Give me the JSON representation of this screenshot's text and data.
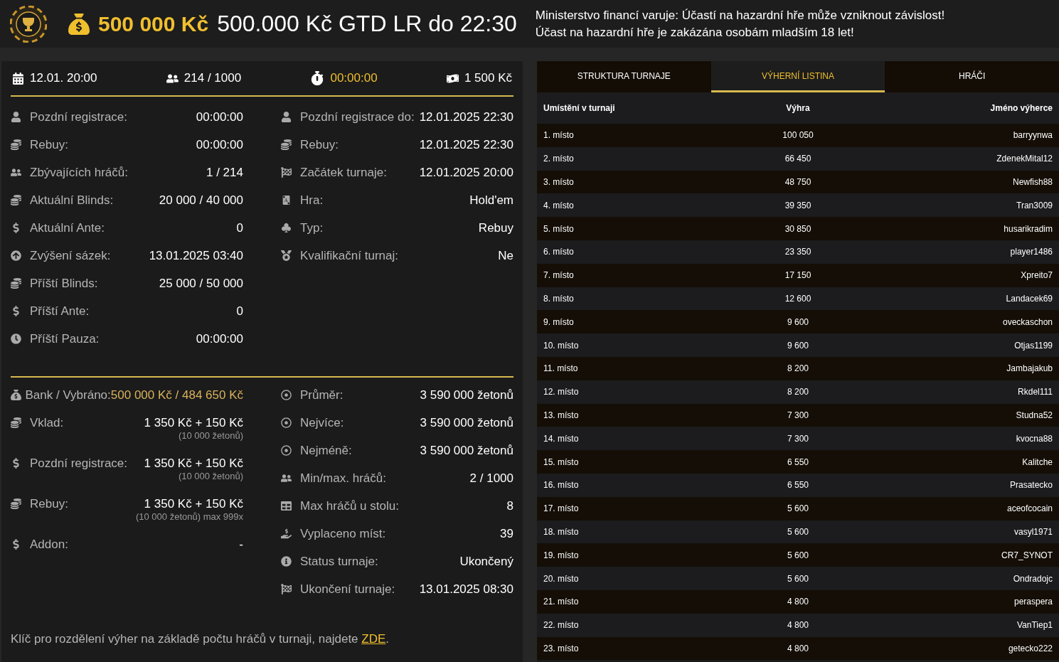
{
  "header": {
    "prize": "500 000 Kč",
    "title": "500.000 Kč GTD LR do 22:30",
    "warning": [
      "Ministerstvo financí varuje: Účastí na hazardní hře může vzniknout závislost!",
      "Účast na hazardní hře je zakázána osobám mladším 18 let!"
    ]
  },
  "summary": [
    {
      "text": "12.01. 20:00",
      "accent": false
    },
    {
      "text": "214 / 1000",
      "accent": false
    },
    {
      "text": "00:00:00",
      "accent": true
    },
    {
      "text": "1 500 Kč",
      "accent": false
    }
  ],
  "details_left": [
    {
      "label": "Pozdní registrace:",
      "value": "00:00:00"
    },
    {
      "label": "Rebuy:",
      "value": "00:00:00"
    },
    {
      "label": "Zbývajících hráčů:",
      "value": "1 / 214"
    },
    {
      "label": "Aktuální Blinds:",
      "value": "20 000 / 40 000"
    },
    {
      "label": "Aktuální Ante:",
      "value": "0"
    },
    {
      "label": "Zvýšení sázek:",
      "value": "13.01.2025 03:40"
    },
    {
      "label": "Příští Blinds:",
      "value": "25 000 / 50 000"
    },
    {
      "label": "Příští Ante:",
      "value": "0"
    },
    {
      "label": "Příští Pauza:",
      "value": "00:00:00"
    }
  ],
  "details_right": [
    {
      "label": "Pozdní registrace do:",
      "value": "12.01.2025 22:30"
    },
    {
      "label": "Rebuy:",
      "value": "12.01.2025 22:30"
    },
    {
      "label": "Začátek turnaje:",
      "value": "12.01.2025 20:00"
    },
    {
      "label": "Hra:",
      "value": "Hold'em"
    },
    {
      "label": "Typ:",
      "value": "Rebuy"
    },
    {
      "label": "Kvalifikační turnaj:",
      "value": "Ne"
    }
  ],
  "finance_left": [
    {
      "label": "Bank / Vybráno:",
      "value": "500 000 Kč / 484 650 Kč",
      "accent": true
    },
    {
      "label": "Vklad:",
      "value": "1 350 Kč + 150 Kč",
      "note": "(10 000 žetonů)",
      "accent": false
    },
    {
      "label": "Pozdní registrace:",
      "value": "1 350 Kč + 150 Kč",
      "note": "(10 000 žetonů)",
      "accent": false
    },
    {
      "label": "Rebuy:",
      "value": "1 350 Kč + 150 Kč",
      "note": "(10 000 žetonů) max 999x",
      "accent": false
    },
    {
      "label": "Addon:",
      "value": "-",
      "accent": false
    }
  ],
  "finance_right": [
    {
      "label": "Průměr:",
      "value": "3 590 000 žetonů"
    },
    {
      "label": "Nejvíce:",
      "value": "3 590 000 žetonů"
    },
    {
      "label": "Nejméně:",
      "value": "3 590 000 žetonů"
    },
    {
      "label": "Min/max. hráčů:",
      "value": "2 / 1000"
    },
    {
      "label": "Max hráčů u stolu:",
      "value": "8"
    },
    {
      "label": "Vyplaceno míst:",
      "value": "39"
    },
    {
      "label": "Status turnaje:",
      "value": "Ukončený"
    },
    {
      "label": "Ukončení turnaje:",
      "value": "13.01.2025 08:30"
    }
  ],
  "footnote": {
    "text": "Klíč pro rozdělení výher na základě počtu hráčů v turnaji, najdete",
    "link": "ZDE",
    "end": "."
  },
  "tabs": [
    {
      "label": "STRUKTURA TURNAJE",
      "selected": false
    },
    {
      "label": "VÝHERNÍ LISTINA",
      "selected": true
    },
    {
      "label": "HRÁČI",
      "selected": false
    }
  ],
  "table": {
    "columns": [
      "Umístění v turnaji",
      "Výhra",
      "Jméno výherce"
    ],
    "rows": [
      [
        "1. místo",
        "100 050",
        "barryynwa"
      ],
      [
        "2. místo",
        "66 450",
        "ZdenekMital12"
      ],
      [
        "3. místo",
        "48 750",
        "Newfish88"
      ],
      [
        "4. místo",
        "39 350",
        "Tran3009"
      ],
      [
        "5. místo",
        "30 850",
        "husarikradim"
      ],
      [
        "6. místo",
        "23 350",
        "player1486"
      ],
      [
        "7. místo",
        "17 150",
        "Xpreito7"
      ],
      [
        "8. místo",
        "12 600",
        "Landacek69"
      ],
      [
        "9. místo",
        "9 600",
        "oveckaschon"
      ],
      [
        "10. místo",
        "9 600",
        "Otjas1199"
      ],
      [
        "11. místo",
        "8 200",
        "Jambajakub"
      ],
      [
        "12. místo",
        "8 200",
        "Rkdel111"
      ],
      [
        "13. místo",
        "7 300",
        "Studna52"
      ],
      [
        "14. místo",
        "7 300",
        "kvocna88"
      ],
      [
        "15. místo",
        "6 550",
        "Kalitche"
      ],
      [
        "16. místo",
        "6 550",
        "Prasatecko"
      ],
      [
        "17. místo",
        "5 600",
        "aceofcocain"
      ],
      [
        "18. místo",
        "5 600",
        "vasyl1971"
      ],
      [
        "19. místo",
        "5 600",
        "CR7_SYNOT"
      ],
      [
        "20. místo",
        "5 600",
        "Ondradojc"
      ],
      [
        "21. místo",
        "4 800",
        "peraspera"
      ],
      [
        "22. místo",
        "4 800",
        "VanTiep1"
      ],
      [
        "23. místo",
        "4 800",
        "getecko222"
      ]
    ]
  }
}
